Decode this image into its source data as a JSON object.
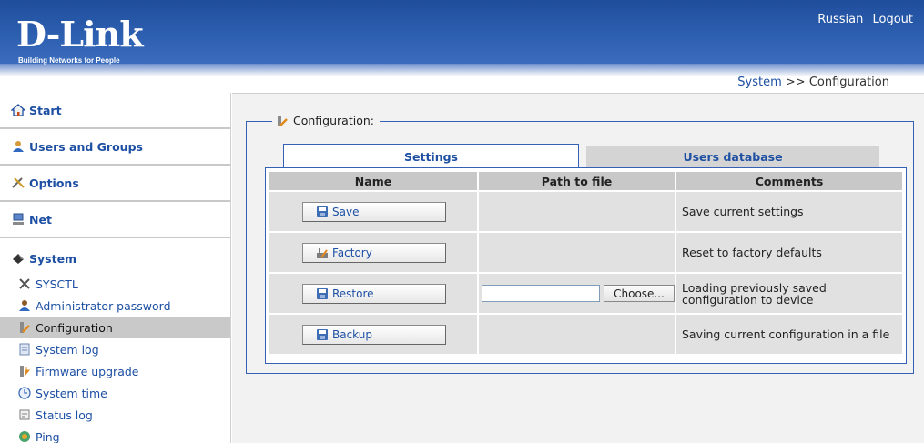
{
  "header": {
    "logo": "D-Link",
    "tagline": "Building Networks for People",
    "links": [
      "Russian",
      "Logout"
    ]
  },
  "breadcrumb": {
    "parent": "System",
    "separator": ">>",
    "current": "Configuration"
  },
  "sidebar": {
    "groups": [
      {
        "label": "Start",
        "icon": "home-icon"
      },
      {
        "label": "Users and Groups",
        "icon": "users-icon"
      },
      {
        "label": "Options",
        "icon": "tools-icon"
      },
      {
        "label": "Net",
        "icon": "network-icon"
      },
      {
        "label": "System",
        "icon": "system-icon"
      }
    ],
    "system_items": [
      {
        "label": "SYSCTL",
        "icon": "wrench-icon"
      },
      {
        "label": "Administrator password",
        "icon": "admin-icon"
      },
      {
        "label": "Configuration",
        "icon": "config-icon",
        "active": true
      },
      {
        "label": "System log",
        "icon": "log-icon"
      },
      {
        "label": "Firmware upgrade",
        "icon": "firmware-icon"
      },
      {
        "label": "System time",
        "icon": "clock-icon"
      },
      {
        "label": "Status log",
        "icon": "status-icon"
      },
      {
        "label": "Ping",
        "icon": "ping-icon"
      }
    ]
  },
  "panel": {
    "legend": "Configuration:",
    "tabs": [
      "Settings",
      "Users database"
    ],
    "columns": [
      "Name",
      "Path to file",
      "Comments"
    ],
    "rows": [
      {
        "button": "Save",
        "comment": "Save current settings"
      },
      {
        "button": "Factory",
        "comment": "Reset to factory defaults"
      },
      {
        "button": "Restore",
        "comment": "Loading previously saved configuration to device"
      },
      {
        "button": "Backup",
        "comment": "Saving current configuration in a file"
      }
    ],
    "file": {
      "value": "",
      "choose_label": "Choose..."
    }
  },
  "colors": {
    "brand_blue": "#1f4d9c",
    "link_blue": "#1d4fa3",
    "frame_blue": "#3461b5",
    "active_item_bg": "#c9c9c9"
  }
}
